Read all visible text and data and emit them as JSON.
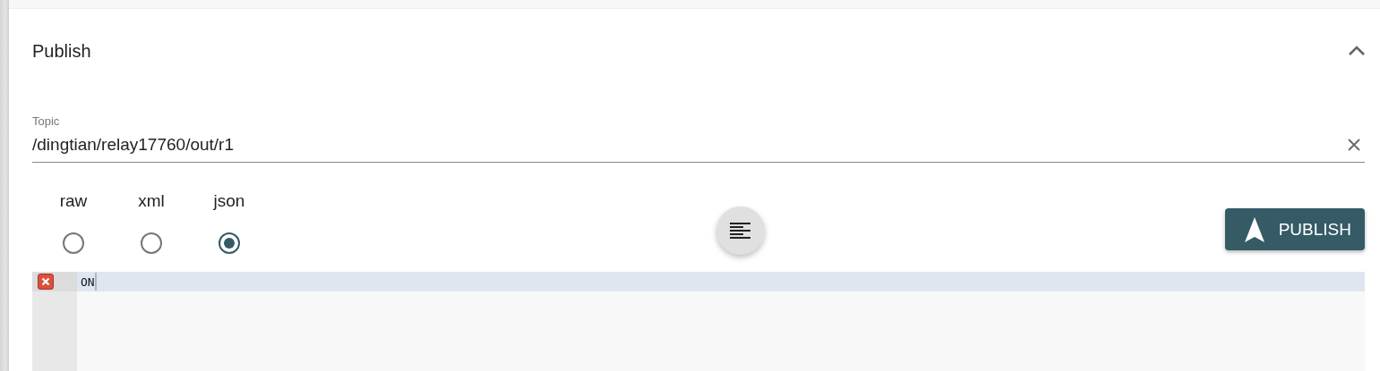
{
  "panel": {
    "title": "Publish",
    "expanded": true
  },
  "topic": {
    "label": "Topic",
    "value": "/dingtian/relay17760/out/r1"
  },
  "formats": [
    {
      "label": "raw",
      "selected": false
    },
    {
      "label": "xml",
      "selected": false
    },
    {
      "label": "json",
      "selected": true
    }
  ],
  "publish_button": {
    "label": "PUBLISH"
  },
  "editor": {
    "lines": [
      {
        "text": "ON",
        "error": true,
        "active": true
      }
    ]
  }
}
